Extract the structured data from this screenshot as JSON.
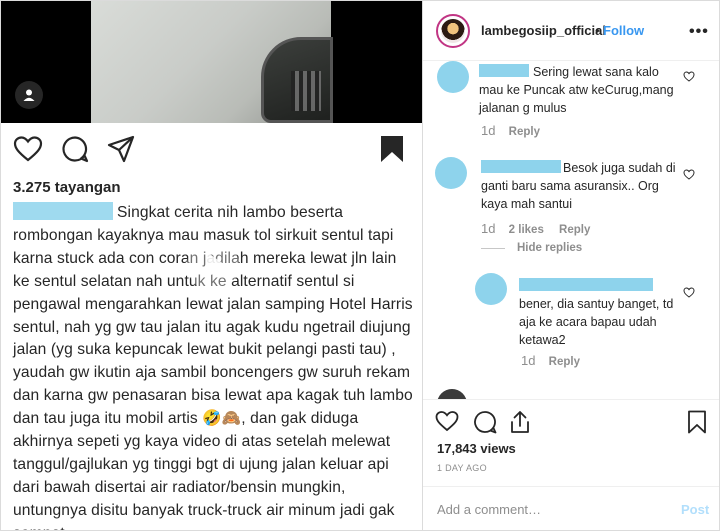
{
  "repost": {
    "views": "3.275 tayangan",
    "caption": "Singkat cerita nih lambo beserta rombongan kayaknya mau masuk tol sirkuit sentul tapi karna stuck ada con coran jadilah mereka lewat jln lain ke sentul selatan nah untuk ke alternatif sentul si pengawal mengarahkan lewat jalan samping Hotel Harris sentul, nah yg gw tau jalan itu agak kudu ngetrail diujung jalan (yg suka kepuncak lewat bukit pelangi pasti tau) , yaudah gw ikutin aja sambil boncengers gw suruh rekam dan karna gw penasaran bisa lewat apa kagak tuh lambo dan tau juga itu mobil artis 🤣🙈, dan gak diduga akhirnya sepeti yg kaya video di atas setelah melewat tanggul/gajlukan yg tinggi bgt di ujung jalan keluar api dari bawah disertai air radiator/bensin mungkin, untungnya disitu banyak truck-truck air minum jadi gak sempat",
    "icons": [
      "heart-icon",
      "comment-icon",
      "share-icon",
      "bookmark-icon",
      "user-tag-icon",
      "play-icon"
    ]
  },
  "post": {
    "username": "lambegosiip_official",
    "separator": "•",
    "follow_label": "Follow",
    "more_label": "•••",
    "comments": [
      {
        "text": "Sering lewat sana kalo mau ke Puncak atw keCurug,mang jalanan g mulus",
        "age": "1d",
        "likes": "",
        "reply": "Reply"
      },
      {
        "text": "Besok juga sudah di ganti baru sama asuransix.. Org kaya mah santui",
        "age": "1d",
        "likes": "2 likes",
        "reply": "Reply",
        "hide_replies": "Hide replies"
      },
      {
        "text": "bener, dia santuy banget, td aja ke acara bapau udah ketawa2",
        "age": "1d",
        "likes": "",
        "reply": "Reply"
      }
    ],
    "views": "17,843 views",
    "date": "1 DAY AGO",
    "comment_placeholder": "Add a comment…",
    "post_label": "Post"
  }
}
